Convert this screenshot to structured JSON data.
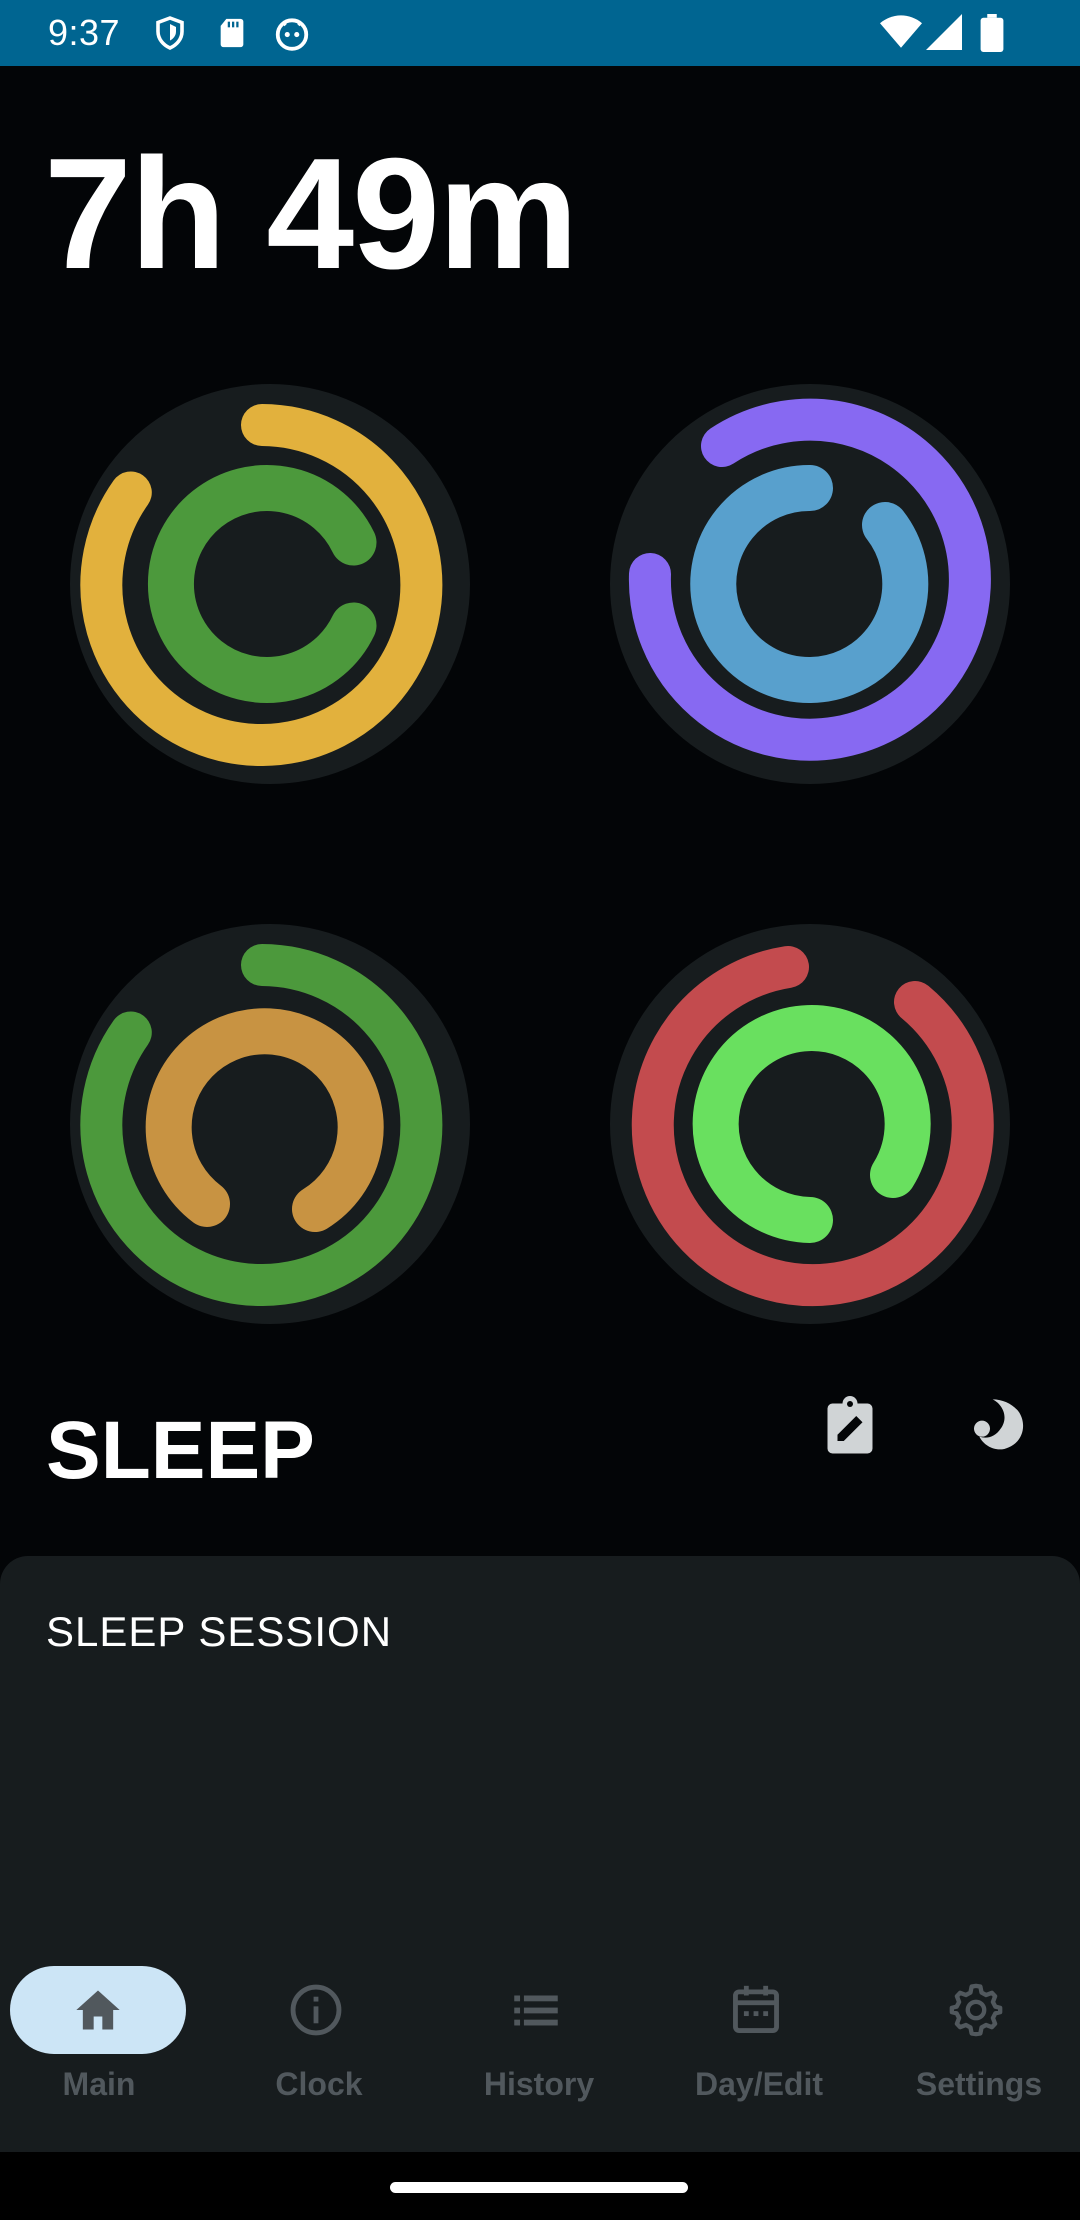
{
  "status_bar": {
    "time": "9:37",
    "left_icons": [
      "shield-icon",
      "sd-card-icon",
      "android-debug-icon"
    ],
    "right_icons": [
      "wifi-icon",
      "signal-icon",
      "battery-icon"
    ]
  },
  "summary": {
    "total_duration": "7h 49m"
  },
  "rings": [
    {
      "outer_color": "#e2b13d",
      "inner_color": "#4c993c"
    },
    {
      "outer_color": "#8769f2",
      "inner_color": "#58a0cd"
    },
    {
      "outer_color": "#4c993c",
      "inner_color": "#c89342"
    },
    {
      "outer_color": "#c34b4e",
      "inner_color": "#69e05f"
    }
  ],
  "section": {
    "title": "SLEEP",
    "actions": [
      "edit-clipboard-icon",
      "moon-icon"
    ]
  },
  "card": {
    "title": "SLEEP SESSION"
  },
  "nav": {
    "items": [
      {
        "label": "Main",
        "icon": "home-icon",
        "active": true
      },
      {
        "label": "Clock",
        "icon": "info-icon",
        "active": false
      },
      {
        "label": "History",
        "icon": "list-icon",
        "active": false
      },
      {
        "label": "Day/Edit",
        "icon": "calendar-icon",
        "active": false
      },
      {
        "label": "Settings",
        "icon": "gear-icon",
        "active": false
      }
    ]
  },
  "colors": {
    "status_bar": "#006591",
    "background": "#030507",
    "card": "#171c1e",
    "nav_active_pill": "#cce5f6",
    "nav_label": "#51585d"
  }
}
